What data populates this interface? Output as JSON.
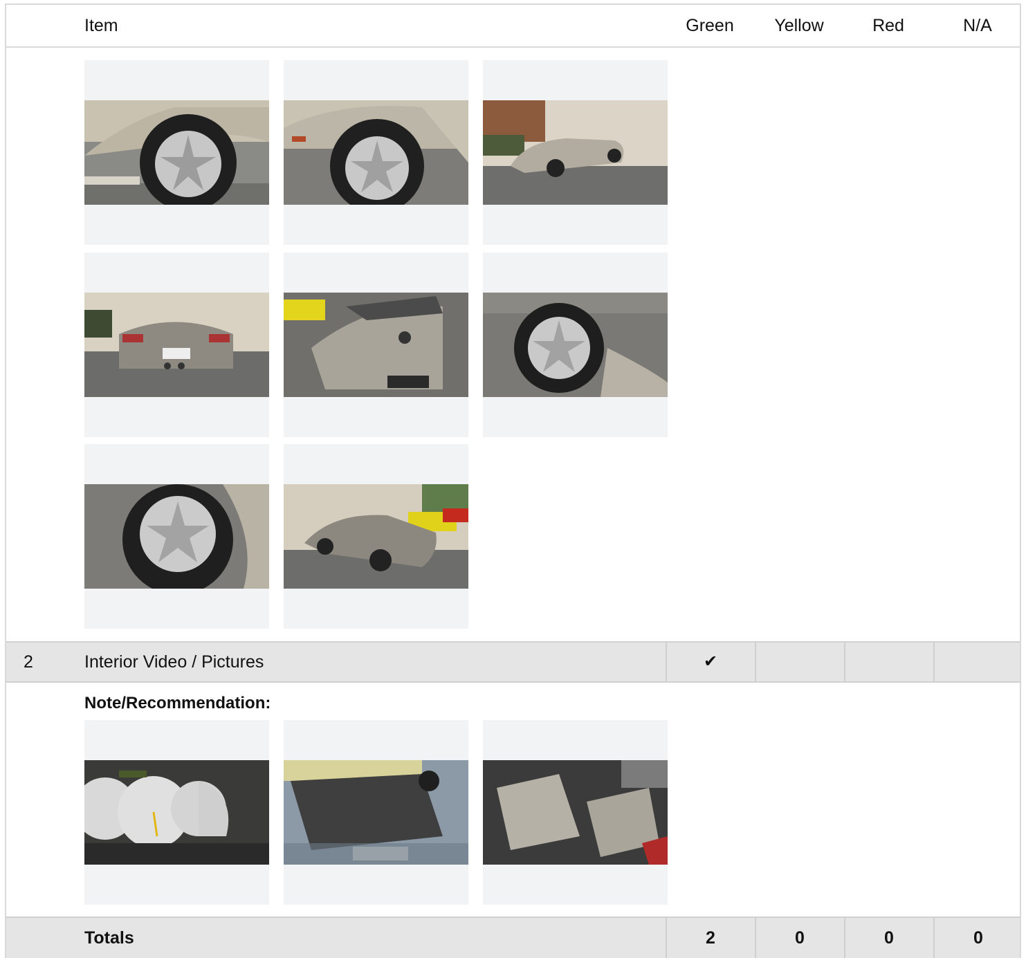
{
  "header": {
    "item_label": "Item",
    "green_label": "Green",
    "yellow_label": "Yellow",
    "red_label": "Red",
    "na_label": "N/A"
  },
  "section1": {
    "photos": [
      "wheel-photo",
      "wheel-photo",
      "car-side-photo",
      "car-rear-photo",
      "car-front-photo",
      "wheel-photo",
      "wheel-photo",
      "car-rear-quarter-photo"
    ]
  },
  "row2": {
    "number": "2",
    "label": "Interior Video / Pictures",
    "green": "✔",
    "yellow": "",
    "red": "",
    "na": ""
  },
  "section2": {
    "note_label": "Note/Recommendation:",
    "photos": [
      "dashboard-gauges-photo",
      "door-panel-photo",
      "seat-interior-photo"
    ]
  },
  "totals": {
    "label": "Totals",
    "green": "2",
    "yellow": "0",
    "red": "0",
    "na": "0"
  }
}
